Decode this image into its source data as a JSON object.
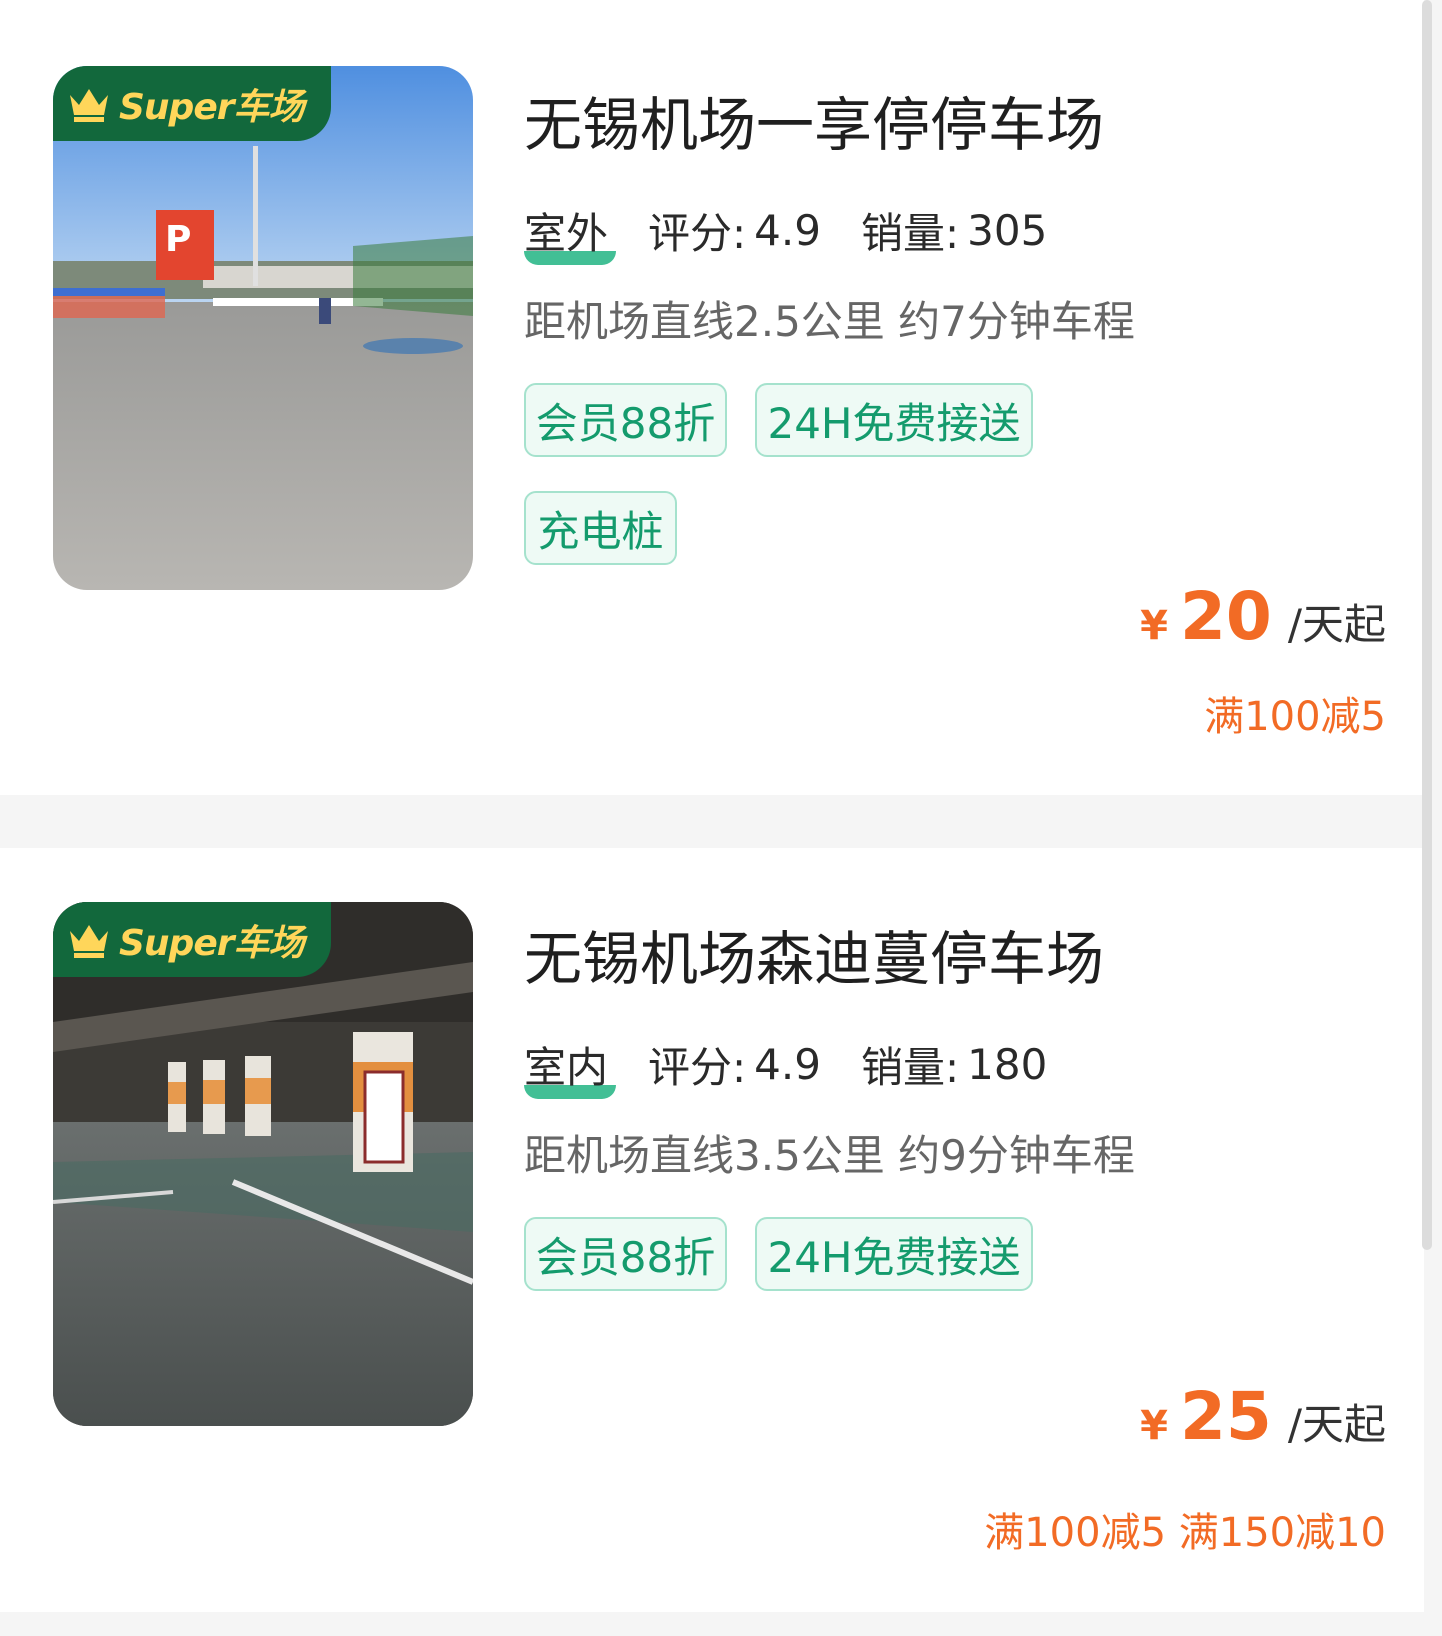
{
  "badge": {
    "text": "Super车场",
    "icon": "crown-icon",
    "color": "#12683c",
    "text_color": "#ffd65a"
  },
  "accent_color": "#f26b25",
  "tag_color": "#149b6d",
  "listings": [
    {
      "title": "无锡机场一享停停车场",
      "type": "室外",
      "rating_label": "评分:",
      "rating": "4.9",
      "sales_label": "销量:",
      "sales": "305",
      "distance": "距机场直线2.5公里 约7分钟车程",
      "tags": [
        "会员88折",
        "24H免费接送",
        "充电桩"
      ],
      "currency": "¥",
      "price": "20",
      "price_unit": "/天起",
      "promo": "满100减5"
    },
    {
      "title": "无锡机场森迪蔓停车场",
      "type": "室内",
      "rating_label": "评分:",
      "rating": "4.9",
      "sales_label": "销量:",
      "sales": "180",
      "distance": "距机场直线3.5公里 约9分钟车程",
      "tags": [
        "会员88折",
        "24H免费接送"
      ],
      "currency": "¥",
      "price": "25",
      "price_unit": "/天起",
      "promo": "满100减5 满150减10"
    }
  ]
}
